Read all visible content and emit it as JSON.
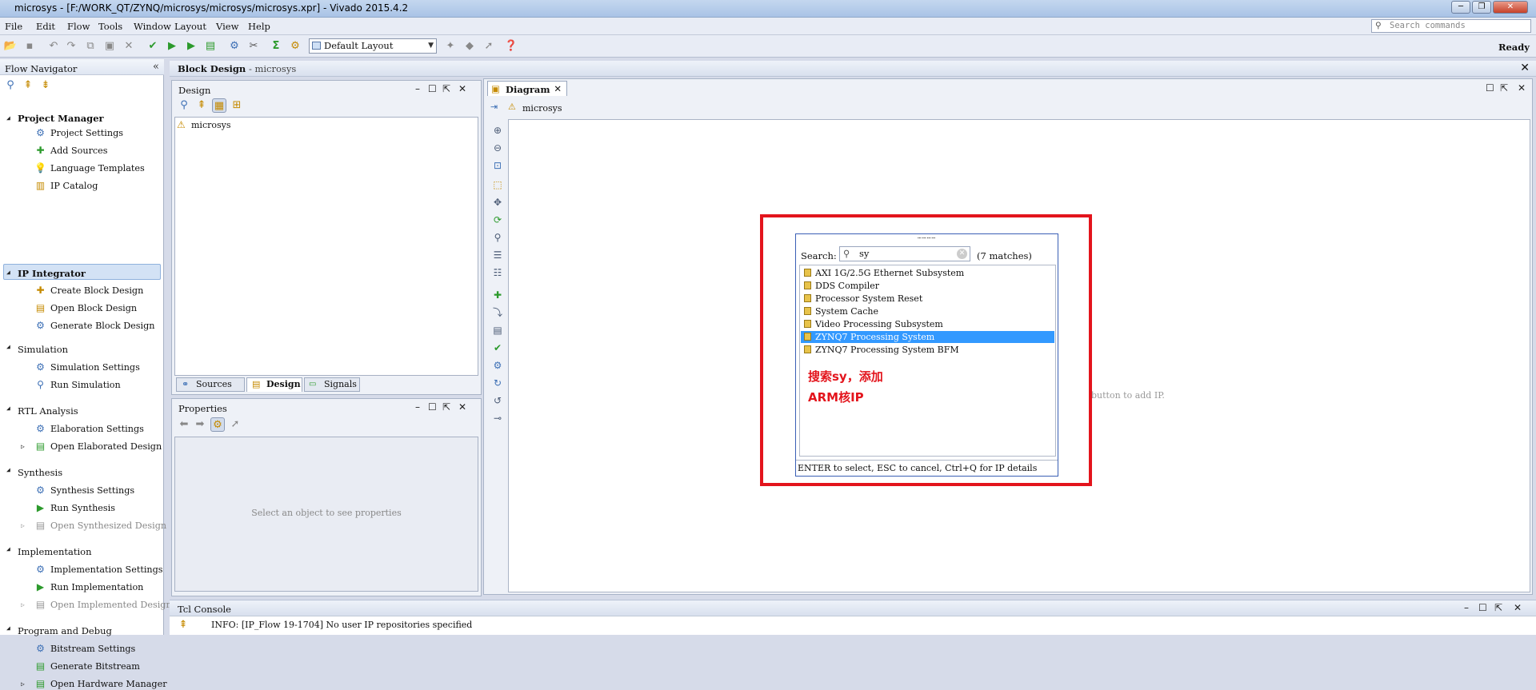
{
  "window": {
    "title": "microsys - [F:/WORK_QT/ZYNQ/microsys/microsys/microsys.xpr] - Vivado 2015.4.2"
  },
  "menu": [
    "File",
    "Edit",
    "Flow",
    "Tools",
    "Window",
    "Layout",
    "View",
    "Help"
  ],
  "search_commands": {
    "placeholder": "Search commands"
  },
  "toolbar": {
    "layout": "Default Layout",
    "status": "Ready"
  },
  "flow_navigator": {
    "title": "Flow Navigator",
    "sections": [
      {
        "label": "Project Manager",
        "items": [
          "Project Settings",
          "Add Sources",
          "Language Templates",
          "IP Catalog"
        ]
      },
      {
        "label": "IP Integrator",
        "items": [
          "Create Block Design",
          "Open Block Design",
          "Generate Block Design"
        ]
      },
      {
        "label": "Simulation",
        "items": [
          "Simulation Settings",
          "Run Simulation"
        ]
      },
      {
        "label": "RTL Analysis",
        "items": [
          "Elaboration Settings",
          "Open Elaborated Design"
        ]
      },
      {
        "label": "Synthesis",
        "items": [
          "Synthesis Settings",
          "Run Synthesis",
          "Open Synthesized Design"
        ]
      },
      {
        "label": "Implementation",
        "items": [
          "Implementation Settings",
          "Run Implementation",
          "Open Implemented Design"
        ]
      },
      {
        "label": "Program and Debug",
        "items": [
          "Bitstream Settings",
          "Generate Bitstream",
          "Open Hardware Manager"
        ]
      }
    ]
  },
  "block_design": {
    "title": "Block Design",
    "subtitle": "- microsys"
  },
  "design_panel": {
    "title": "Design",
    "root": "microsys",
    "tabs": [
      "Sources",
      "Design",
      "Signals"
    ]
  },
  "properties": {
    "title": "Properties",
    "empty_msg": "Select an object to see properties"
  },
  "diagram": {
    "tab": "Diagram",
    "breadcrumb": "microsys",
    "hint": "button to add IP."
  },
  "ip_search": {
    "label": "Search:",
    "query": "sy",
    "matches": "(7 matches)",
    "items": [
      "AXI 1G/2.5G Ethernet Subsystem",
      "DDS Compiler",
      "Processor System Reset",
      "System Cache",
      "Video Processing Subsystem",
      "ZYNQ7 Processing System",
      "ZYNQ7 Processing System BFM"
    ],
    "selected_index": 5,
    "footer": "ENTER to select, ESC to cancel, Ctrl+Q for IP details"
  },
  "annotation": {
    "line1": "搜索sy，添加",
    "line2": "ARM核IP"
  },
  "tcl_console": {
    "title": "Tcl Console",
    "line": "INFO: [IP_Flow 19-1704] No user IP repositories specified"
  }
}
